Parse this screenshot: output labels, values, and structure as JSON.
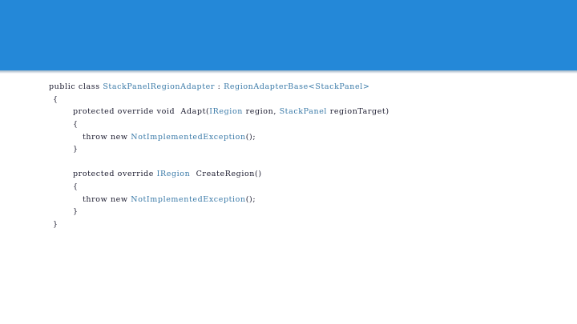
{
  "slide": {
    "header_color": "#2488d8",
    "code": {
      "line1": {
        "kw1": "public",
        "kw2": "class",
        "name": "StackPanelRegionAdapter",
        "sep": ":",
        "base": "RegionAdapterBase<StackPanel>"
      },
      "line2": "{",
      "line3": {
        "kw1": "protected",
        "kw2": "override",
        "kw3": "void",
        "method": "Adapt(",
        "t1": "IRegion",
        "p1": "region,",
        "t2": "StackPanel",
        "p2": "regionTarget)"
      },
      "line4": "{",
      "line5": {
        "kw1": "throw",
        "kw2": "new",
        "ex": "NotImplementedException",
        "tail": "();"
      },
      "line6": "}",
      "line7": {
        "kw1": "protected",
        "kw2": "override",
        "t1": "IRegion",
        "method": "CreateRegion()"
      },
      "line8": "{",
      "line9": {
        "kw1": "throw",
        "kw2": "new",
        "ex": "NotImplementedException",
        "tail": "();"
      },
      "line10": "}",
      "line11": "}"
    }
  }
}
